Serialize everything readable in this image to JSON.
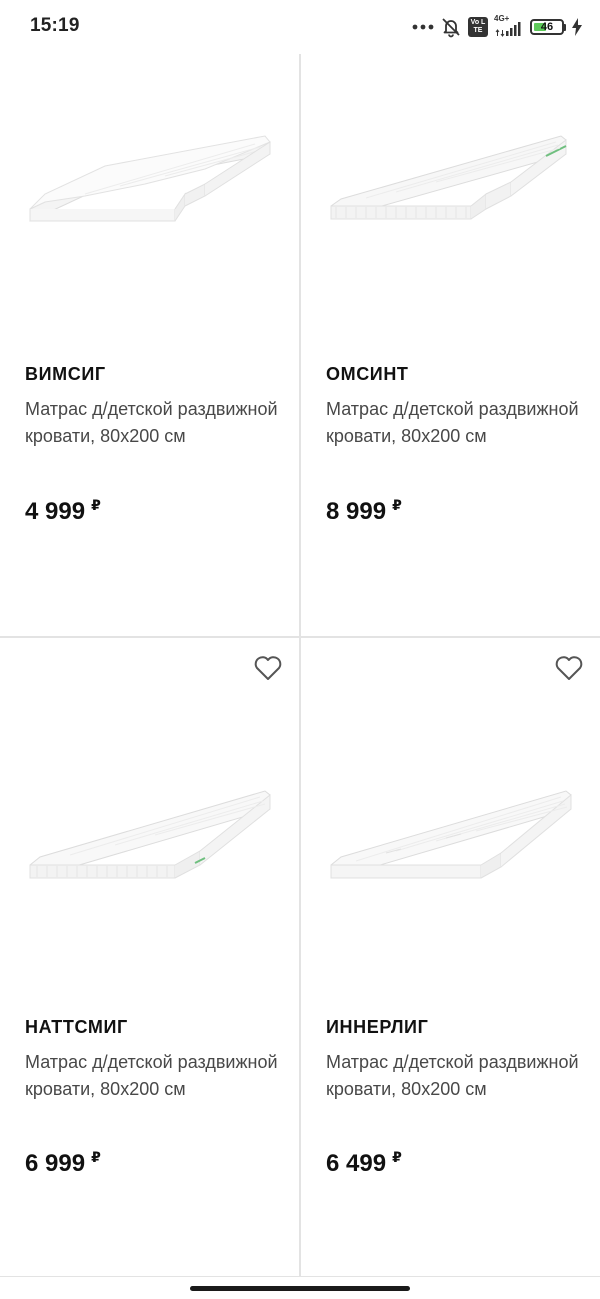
{
  "status_bar": {
    "time": "15:19",
    "network_badge": "Vo LTE",
    "network_type": "4G+",
    "battery_level": "46",
    "battery_fraction": 0.46,
    "icons": [
      "more-dots-icon",
      "bell-muted-icon",
      "volte-icon",
      "signal-icon",
      "battery-icon",
      "charging-icon"
    ]
  },
  "colors": {
    "background": "#ffffff",
    "text_primary": "#111111",
    "text_secondary": "#484848",
    "divider": "#e3e3e3",
    "battery_fill": "#5ec95a"
  },
  "products": [
    {
      "name": "ВИМСИГ",
      "description": "Матрас д/детской раздвижной кровати, 80x200 см",
      "price": "4 999",
      "currency": "₽",
      "favorite_visible": false
    },
    {
      "name": "ОМСИНТ",
      "description": "Матрас д/детской раздвижной кровати, 80x200 см",
      "price": "8 999",
      "currency": "₽",
      "favorite_visible": false
    },
    {
      "name": "НАТТСМИГ",
      "description": "Матрас д/детской раздвижной кровати, 80x200 см",
      "price": "6 999",
      "currency": "₽",
      "favorite_visible": true
    },
    {
      "name": "ИННЕРЛИГ",
      "description": "Матрас д/детской раздвижной кровати, 80x200 см",
      "price": "6 499",
      "currency": "₽",
      "favorite_visible": true
    }
  ]
}
